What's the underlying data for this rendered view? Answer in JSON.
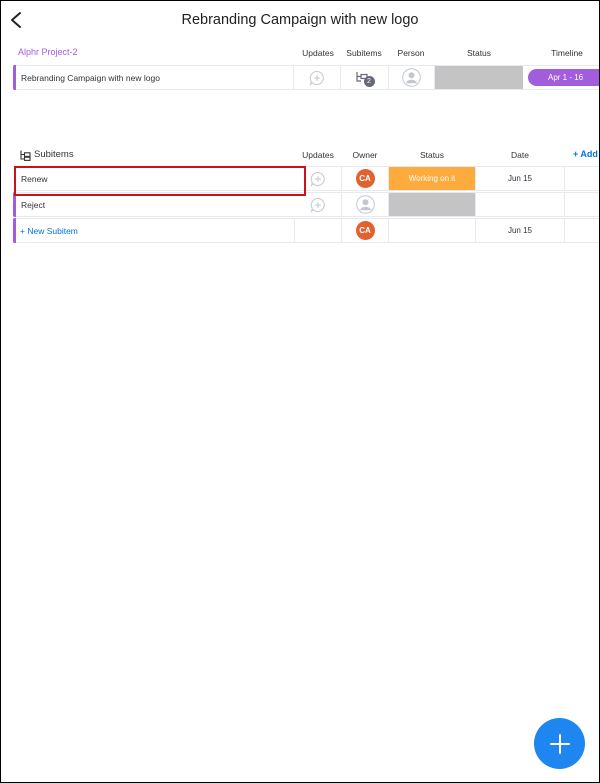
{
  "header": {
    "title": "Rebranding Campaign with new logo"
  },
  "group": {
    "name": "Alphr Project-2",
    "columns": {
      "updates": "Updates",
      "subitems": "Subitems",
      "person": "Person",
      "status": "Status",
      "timeline": "Timeline"
    },
    "item": {
      "name": "Rebranding Campaign with new logo",
      "subitem_count": "2",
      "status": "",
      "timeline": "Apr 1 - 16"
    }
  },
  "subitems": {
    "title": "Subitems",
    "columns": {
      "updates": "Updates",
      "owner": "Owner",
      "status": "Status",
      "date": "Date",
      "add": "+ Add"
    },
    "rows": [
      {
        "name": "Renew",
        "owner": "CA",
        "status": "Working on it",
        "date": "Jun 15"
      },
      {
        "name": "Reject",
        "owner": "",
        "status": "",
        "date": ""
      }
    ],
    "summary": {
      "owner": "CA",
      "date": "Jun 15"
    },
    "new_label": "+ New Subitem"
  },
  "colors": {
    "accent": "#a25ddc",
    "working_on_it": "#fdab3d",
    "empty_status": "#c4c4c4",
    "owner_avatar": "#e2622f",
    "fab": "#1f86ef",
    "link": "#0073ea",
    "highlight": "#c8121c"
  },
  "icons": {
    "back": "chevron-left-icon",
    "update": "add-update-icon",
    "subitems": "subitems-icon",
    "person": "person-placeholder-icon",
    "fab": "plus-icon"
  }
}
